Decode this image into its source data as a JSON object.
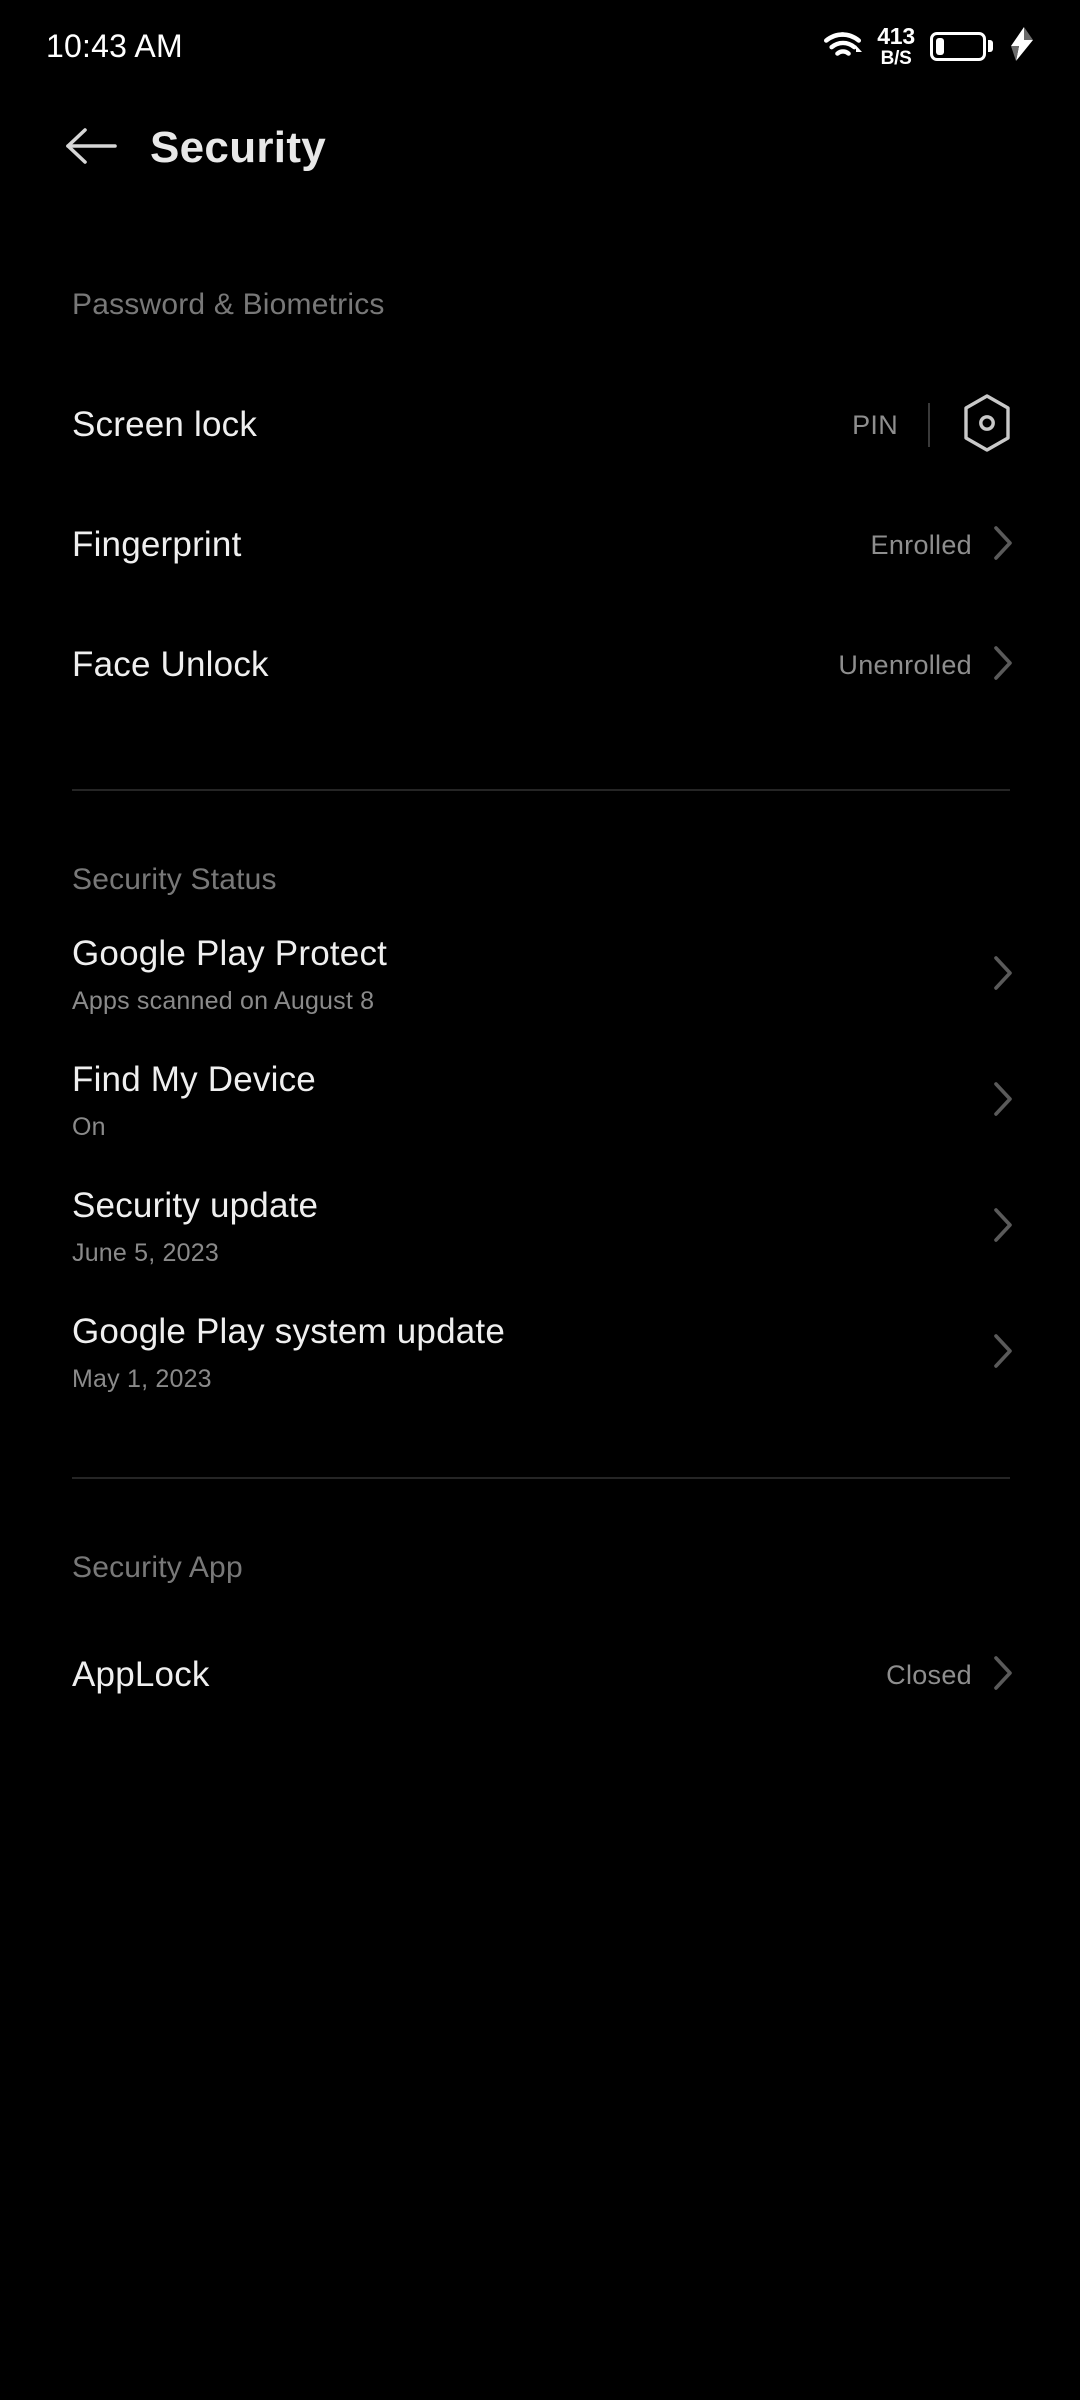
{
  "status_bar": {
    "clock": "10:43 AM",
    "wifi_icon": "wifi-icon",
    "network_speed_rate": "413",
    "network_speed_unit": "B/S",
    "battery_icon": "battery-low-icon",
    "charging_icon": "charging-bolt-icon"
  },
  "app_bar": {
    "back_icon": "back-arrow-icon",
    "title": "Security"
  },
  "sections": [
    {
      "header": "Password & Biometrics",
      "rows": [
        {
          "title": "Screen lock",
          "value": "PIN",
          "trailing_icon": "hex-gear-icon"
        },
        {
          "title": "Fingerprint",
          "value": "Enrolled",
          "trailing_icon": "chevron-right-icon"
        },
        {
          "title": "Face Unlock",
          "value": "Unenrolled",
          "trailing_icon": "chevron-right-icon"
        }
      ]
    },
    {
      "header": "Security Status",
      "rows": [
        {
          "title": "Google Play Protect",
          "subtitle": "Apps scanned on August 8",
          "trailing_icon": "chevron-right-icon"
        },
        {
          "title": "Find My Device",
          "subtitle": "On",
          "trailing_icon": "chevron-right-icon"
        },
        {
          "title": "Security update",
          "subtitle": "June 5, 2023",
          "trailing_icon": "chevron-right-icon"
        },
        {
          "title": "Google Play system update",
          "subtitle": "May 1, 2023",
          "trailing_icon": "chevron-right-icon"
        }
      ]
    },
    {
      "header": "Security App",
      "rows": [
        {
          "title": "AppLock",
          "value": "Closed",
          "trailing_icon": "chevron-right-icon"
        }
      ]
    }
  ],
  "colors": {
    "background": "#000000",
    "title_text": "#efefef",
    "secondary_text": "#8a8a8a",
    "section_header_text": "#787878",
    "divider": "#252525",
    "icon": "#c9c9c9"
  }
}
